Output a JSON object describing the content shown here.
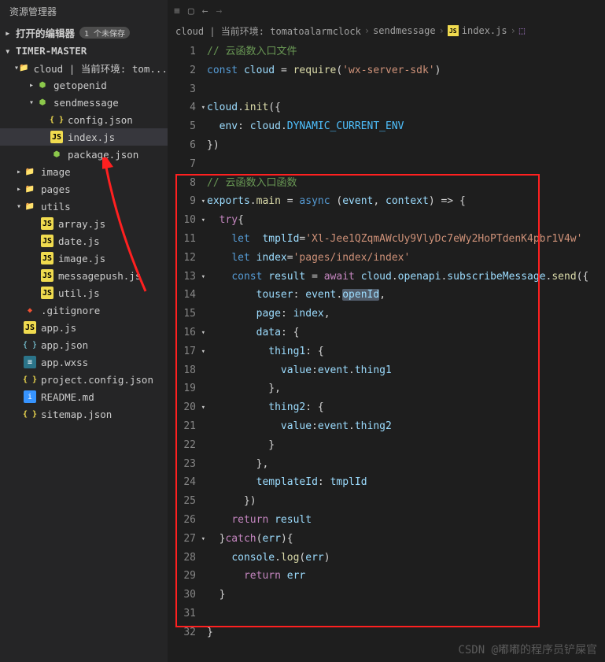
{
  "sidebar": {
    "title": "资源管理器",
    "sections": {
      "openEditors": {
        "label": "打开的编辑器",
        "badge": "1 个未保存"
      },
      "project": {
        "label": "TIMER-MASTER"
      }
    },
    "tree": [
      {
        "pad": 18,
        "chev": "▾",
        "icon": "folder",
        "label": "cloud | 当前环境: tom..."
      },
      {
        "pad": 34,
        "chev": "▸",
        "icon": "node",
        "label": "getopenid"
      },
      {
        "pad": 34,
        "chev": "▾",
        "icon": "node",
        "label": "sendmessage"
      },
      {
        "pad": 52,
        "chev": "",
        "icon": "json",
        "label": "config.json"
      },
      {
        "pad": 52,
        "chev": "",
        "icon": "js",
        "label": "index.js",
        "sel": true
      },
      {
        "pad": 52,
        "chev": "",
        "icon": "node",
        "label": "package.json"
      },
      {
        "pad": 18,
        "chev": "▸",
        "icon": "folder",
        "label": "image"
      },
      {
        "pad": 18,
        "chev": "▸",
        "icon": "folder",
        "label": "pages"
      },
      {
        "pad": 18,
        "chev": "▾",
        "icon": "folder",
        "label": "utils"
      },
      {
        "pad": 40,
        "chev": "",
        "icon": "js",
        "label": "array.js"
      },
      {
        "pad": 40,
        "chev": "",
        "icon": "js",
        "label": "date.js"
      },
      {
        "pad": 40,
        "chev": "",
        "icon": "js",
        "label": "image.js"
      },
      {
        "pad": 40,
        "chev": "",
        "icon": "js",
        "label": "messagepush.js"
      },
      {
        "pad": 40,
        "chev": "",
        "icon": "js",
        "label": "util.js"
      },
      {
        "pad": 18,
        "chev": "",
        "icon": "git",
        "label": ".gitignore"
      },
      {
        "pad": 18,
        "chev": "",
        "icon": "js",
        "label": "app.js"
      },
      {
        "pad": 18,
        "chev": "",
        "icon": "json2",
        "label": "app.json"
      },
      {
        "pad": 18,
        "chev": "",
        "icon": "wxss",
        "label": "app.wxss"
      },
      {
        "pad": 18,
        "chev": "",
        "icon": "json",
        "label": "project.config.json"
      },
      {
        "pad": 18,
        "chev": "",
        "icon": "info",
        "label": "README.md"
      },
      {
        "pad": 18,
        "chev": "",
        "icon": "json",
        "label": "sitemap.json"
      }
    ]
  },
  "breadcrumbs": [
    "cloud | 当前环境: tomatoalarmclock",
    "sendmessage",
    "index.js"
  ],
  "breadcrumb_file_icon": "JS",
  "code_lines": [
    {
      "n": 1,
      "h": "<span class='c-cm'>// 云函数入口文件</span>"
    },
    {
      "n": 2,
      "h": "<span class='c-kw'>const</span> <span class='c-var'>cloud</span> <span class='c-pl'>=</span> <span class='c-fn'>require</span><span class='c-pl'>(</span><span class='c-str'>'wx-server-sdk'</span><span class='c-pl'>)</span>"
    },
    {
      "n": 3,
      "h": ""
    },
    {
      "n": 4,
      "fold": "▾",
      "h": "<span class='c-var'>cloud</span><span class='c-pl'>.</span><span class='c-fn'>init</span><span class='c-pl'>({</span>"
    },
    {
      "n": 5,
      "h": "  <span class='c-prop'>env</span><span class='c-pl'>:</span> <span class='c-var'>cloud</span><span class='c-pl'>.</span><span class='c-const'>DYNAMIC_CURRENT_ENV</span>"
    },
    {
      "n": 6,
      "h": "<span class='c-pl'>})</span>"
    },
    {
      "n": 7,
      "h": ""
    },
    {
      "n": 8,
      "h": "<span class='c-cm'>// 云函数入口函数</span>"
    },
    {
      "n": 9,
      "fold": "▾",
      "h": "<span class='c-var'>exports</span><span class='c-pl'>.</span><span class='c-fn'>main</span> <span class='c-pl'>=</span> <span class='c-kw'>async</span> <span class='c-pl'>(</span><span class='c-var'>event</span><span class='c-pl'>,</span> <span class='c-var'>context</span><span class='c-pl'>) =&gt; {</span>"
    },
    {
      "n": 10,
      "fold": "▾",
      "h": "  <span class='c-kw2'>try</span><span class='c-pl'>{</span>"
    },
    {
      "n": 11,
      "h": "    <span class='c-kw'>let</span>  <span class='c-var'>tmplId</span><span class='c-pl'>=</span><span class='c-str'>'Xl-Jee1QZqmAWcUy9VlyDc7eWy2HoPTdenK4pbr1V4w'</span>"
    },
    {
      "n": 12,
      "h": "    <span class='c-kw'>let</span> <span class='c-var'>index</span><span class='c-pl'>=</span><span class='c-str'>'pages/index/index'</span>"
    },
    {
      "n": 13,
      "fold": "▾",
      "h": "    <span class='c-kw'>const</span> <span class='c-var'>result</span> <span class='c-pl'>=</span> <span class='c-kw2'>await</span> <span class='c-var'>cloud</span><span class='c-pl'>.</span><span class='c-var'>openapi</span><span class='c-pl'>.</span><span class='c-var'>subscribeMessage</span><span class='c-pl'>.</span><span class='c-fn'>send</span><span class='c-pl'>({</span>"
    },
    {
      "n": 14,
      "h": "        <span class='c-prop'>touser</span><span class='c-pl'>:</span> <span class='c-var'>event</span><span class='c-pl'>.</span><span class='c-var hglbl'>openId</span><span class='c-pl'>,</span>"
    },
    {
      "n": 15,
      "h": "        <span class='c-prop'>page</span><span class='c-pl'>:</span> <span class='c-var'>index</span><span class='c-pl'>,</span>"
    },
    {
      "n": 16,
      "fold": "▾",
      "h": "        <span class='c-prop'>data</span><span class='c-pl'>: {</span>"
    },
    {
      "n": 17,
      "fold": "▾",
      "h": "          <span class='c-prop'>thing1</span><span class='c-pl'>: {</span>"
    },
    {
      "n": 18,
      "h": "            <span class='c-prop'>value</span><span class='c-pl'>:</span><span class='c-var'>event</span><span class='c-pl'>.</span><span class='c-var'>thing1</span>"
    },
    {
      "n": 19,
      "h": "          <span class='c-pl'>},</span>"
    },
    {
      "n": 20,
      "fold": "▾",
      "h": "          <span class='c-prop'>thing2</span><span class='c-pl'>: {</span>"
    },
    {
      "n": 21,
      "h": "            <span class='c-prop'>value</span><span class='c-pl'>:</span><span class='c-var'>event</span><span class='c-pl'>.</span><span class='c-var'>thing2</span>"
    },
    {
      "n": 22,
      "h": "          <span class='c-pl'>}</span>"
    },
    {
      "n": 23,
      "h": "        <span class='c-pl'>},</span>"
    },
    {
      "n": 24,
      "h": "        <span class='c-prop'>templateId</span><span class='c-pl'>:</span> <span class='c-var'>tmplId</span>"
    },
    {
      "n": 25,
      "h": "      <span class='c-pl'>})</span>"
    },
    {
      "n": 26,
      "h": "    <span class='c-kw2'>return</span> <span class='c-var'>result</span>"
    },
    {
      "n": 27,
      "fold": "▾",
      "h": "  <span class='c-pl'>}</span><span class='c-kw2'>catch</span><span class='c-pl'>(</span><span class='c-var'>err</span><span class='c-pl'>){</span>"
    },
    {
      "n": 28,
      "h": "    <span class='c-var'>console</span><span class='c-pl'>.</span><span class='c-fn'>log</span><span class='c-pl'>(</span><span class='c-var'>err</span><span class='c-pl'>)</span>"
    },
    {
      "n": 29,
      "h": "      <span class='c-kw2'>return</span> <span class='c-var'>err</span>"
    },
    {
      "n": 30,
      "h": "  <span class='c-pl'>}</span>"
    },
    {
      "n": 31,
      "h": ""
    },
    {
      "n": 32,
      "h": "<span class='c-pl'>}</span>"
    }
  ],
  "watermark": "CSDN @嘟嘟的程序员铲屎官"
}
